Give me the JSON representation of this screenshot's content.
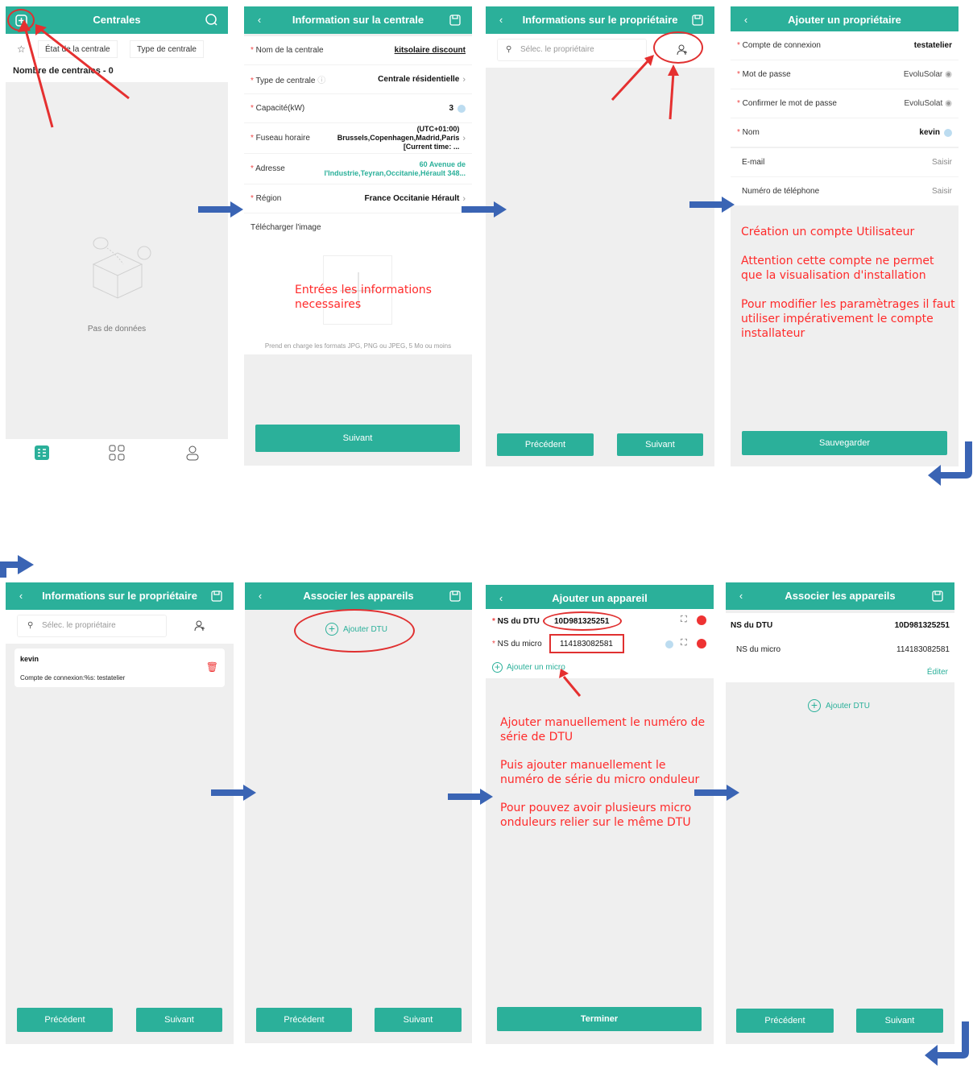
{
  "panel1": {
    "title": "Centrales",
    "filter_state": "État de la centrale",
    "filter_type": "Type de centrale",
    "count": "Nombre de centrales - 0",
    "empty": "Pas de données"
  },
  "panel2": {
    "title": "Information sur la centrale",
    "fields": [
      {
        "label": "Nom de la centrale",
        "value": "kitsolaire discount"
      },
      {
        "label": "Type de centrale",
        "value": "Centrale résidentielle"
      },
      {
        "label": "Capacité(kW)",
        "value": "3"
      },
      {
        "label": "Fuseau horaire",
        "value": "(UTC+01:00) Brussels,Copenhagen,Madrid,Paris [Current time: ..."
      },
      {
        "label": "Adresse",
        "value": "60 Avenue de l'Industrie,Teyran,Occitanie,Hérault 348..."
      },
      {
        "label": "Région",
        "value": "France Occitanie Hérault"
      }
    ],
    "upload_label": "Télécharger l'image",
    "note": "Entrées les informations necessaires",
    "formats": "Prend en charge les formats JPG, PNG ou JPEG, 5 Mo ou moins",
    "next": "Suivant"
  },
  "panel3": {
    "title": "Informations sur le propriétaire",
    "search_placeholder": "Sélec. le propriétaire",
    "prev": "Précédent",
    "next": "Suivant"
  },
  "panel4": {
    "title": "Ajouter un propriétaire",
    "fields": [
      {
        "label": "Compte de connexion",
        "value": "testatelier"
      },
      {
        "label": "Mot de passe",
        "value": "EvoluSolar"
      },
      {
        "label": "Confirmer le mot de passe",
        "value": "EvoluSolat"
      },
      {
        "label": "Nom",
        "value": "kevin"
      },
      {
        "label": "E-mail",
        "value": "Saisir"
      },
      {
        "label": "Numéro de téléphone",
        "value": "Saisir"
      }
    ],
    "note1": "Création un compte Utilisateur",
    "note2": "Attention cette compte ne permet que la visualisation d'installation",
    "note3": "Pour modifier les paramètrages il faut utiliser impérativement le compte installateur",
    "save": "Sauvegarder"
  },
  "panel5": {
    "title": "Informations sur le propriétaire",
    "search_placeholder": "Sélec. le propriétaire",
    "owner_name": "kevin",
    "owner_account": "Compte de connexion:%s: testatelier",
    "prev": "Précédent",
    "next": "Suivant"
  },
  "panel6": {
    "title": "Associer les appareils",
    "add_dtu": "Ajouter DTU",
    "prev": "Précédent",
    "next": "Suivant"
  },
  "panel7": {
    "title": "Ajouter un appareil",
    "dtu_label": "NS du DTU",
    "dtu_value": "10D981325251",
    "micro_label": "NS du micro",
    "micro_value": "114183082581",
    "add_micro": "Ajouter un micro",
    "note1": "Ajouter manuellement le numéro de série de DTU",
    "note2": "Puis ajouter manuellement le numéro de série du micro onduleur",
    "note3": "Pour pouvez avoir plusieurs micro onduleurs relier sur le même DTU",
    "finish": "Terminer"
  },
  "panel8": {
    "title": "Associer les appareils",
    "dtu_label": "NS du DTU",
    "dtu_value": "10D981325251",
    "micro_label": "NS du micro",
    "micro_value": "114183082581",
    "edit": "Éditer",
    "add_dtu": "Ajouter DTU",
    "prev": "Précédent",
    "next": "Suivant"
  },
  "colors": {
    "accent": "#2bb09a",
    "annotation": "#ff2a2a",
    "arrow": "#3a64b4"
  }
}
